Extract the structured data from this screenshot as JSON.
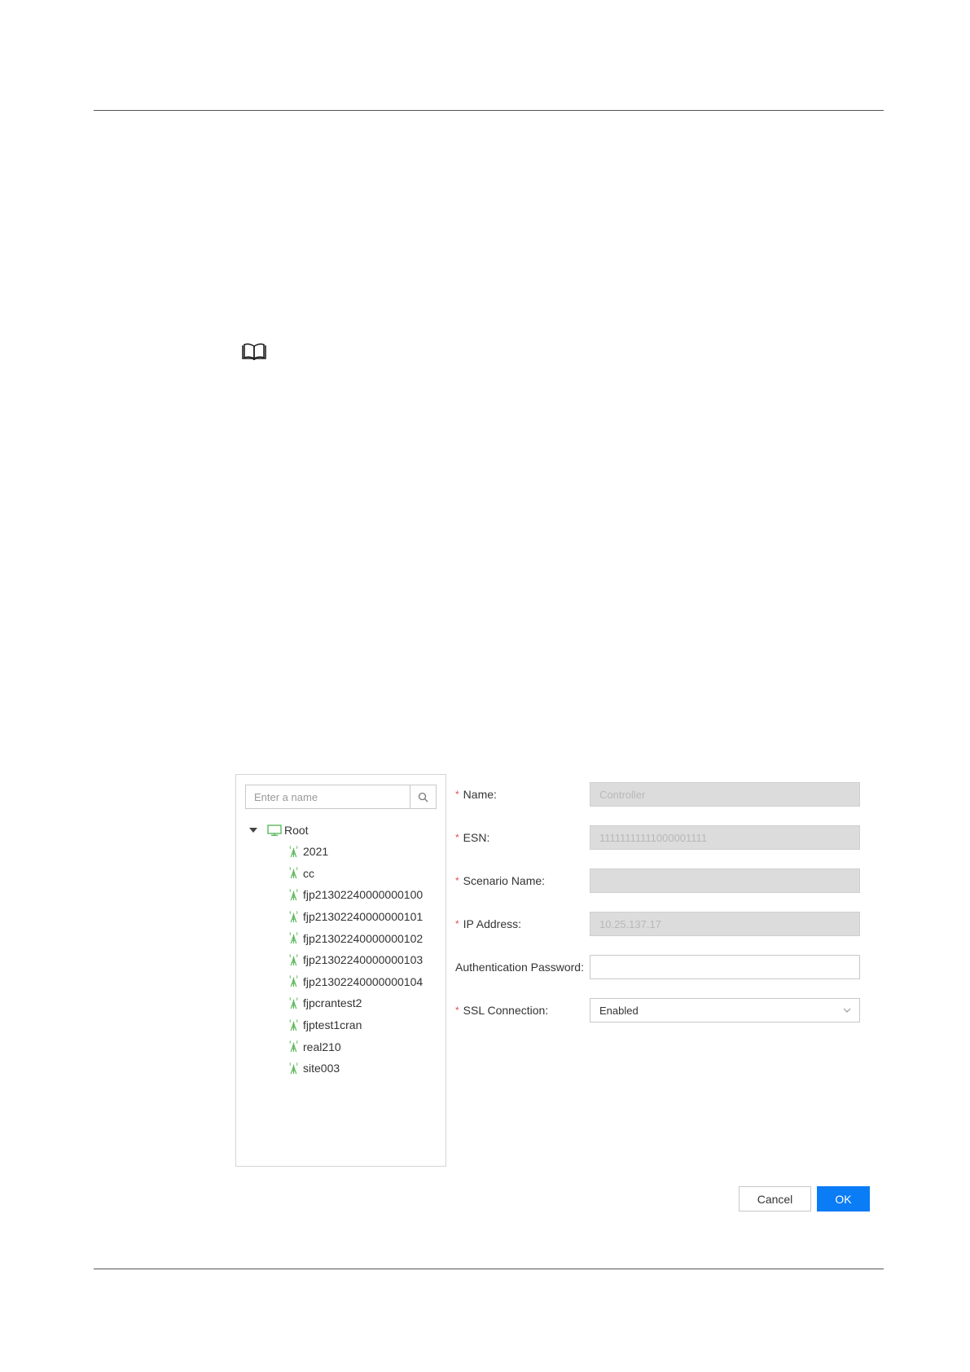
{
  "tree": {
    "search": {
      "placeholder": "Enter a name",
      "icon": "search-icon"
    },
    "root": {
      "label": "Root",
      "icon": "monitor-icon",
      "expanded": true
    },
    "items": [
      "2021",
      "cc",
      "fjp21302240000000100",
      "fjp21302240000000101",
      "fjp21302240000000102",
      "fjp21302240000000103",
      "fjp21302240000000104",
      "fjpcrantest2",
      "fjptest1cran",
      "real210",
      "site003"
    ],
    "item_icon": "base-station-icon"
  },
  "form": {
    "required_mark": "*",
    "name": {
      "label": "Name:",
      "value": "Controller",
      "required": true
    },
    "esn": {
      "label": "ESN:",
      "value": "11111111111000001111",
      "required": true
    },
    "scenario_name": {
      "label": "Scenario Name:",
      "value": "",
      "required": true
    },
    "ip_address": {
      "label": "IP Address:",
      "value": "10.25.137.17",
      "required": true
    },
    "auth_password": {
      "label": "Authentication Password:",
      "value": "",
      "required": false
    },
    "ssl_connection": {
      "label": "SSL Connection:",
      "value": "Enabled",
      "required": true
    }
  },
  "buttons": {
    "cancel": "Cancel",
    "ok": "OK"
  },
  "colors": {
    "primary": "#0a7cf6",
    "required": "#e34d59",
    "tree_icon": "#5cb85c",
    "disabled_field": "#dcdcdc"
  }
}
